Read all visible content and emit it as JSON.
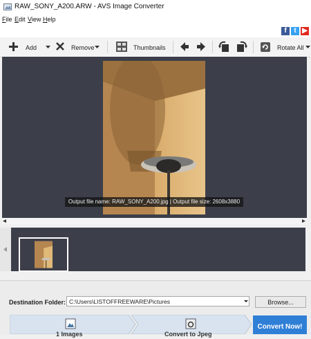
{
  "window": {
    "title": "RAW_SONY_A200.ARW - AVS Image Converter"
  },
  "menu": [
    {
      "label": "File",
      "key": "F",
      "rest": "ile"
    },
    {
      "label": "Edit",
      "key": "E",
      "rest": "dit"
    },
    {
      "label": "View",
      "key": "V",
      "rest": "iew"
    },
    {
      "label": "Help",
      "key": "H",
      "rest": "elp"
    }
  ],
  "social": [
    "facebook-icon",
    "twitter-icon",
    "youtube-icon"
  ],
  "toolbar": {
    "add_label": "Add",
    "remove_label": "Remove",
    "thumbnails_label": "Thumbnails",
    "rotate_all_label": "Rotate All"
  },
  "preview": {
    "output_info": "Output file name: RAW_SONY_A200.jpg | Output file size: 2608x3880"
  },
  "destination": {
    "label": "Destination Folder:",
    "path": "C:\\Users\\LISTOFFREEWARE\\Pictures",
    "browse_label": "Browse..."
  },
  "steps": {
    "step1": "1 Images",
    "step2": "Convert to Jpeg",
    "convert_now": "Convert Now!"
  },
  "colors": {
    "panel": "#3c3f4a",
    "accent": "#2f7fd6"
  }
}
